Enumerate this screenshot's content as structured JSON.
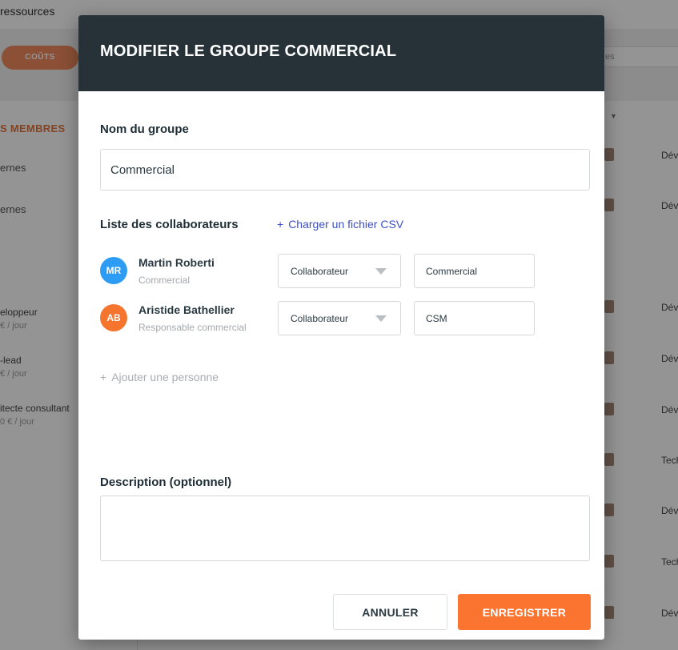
{
  "background": {
    "app_title": "ressources",
    "tab_pill": "COÛTS",
    "search_placeholder": "es",
    "section_title": "S MEMBRES",
    "links": [
      "ernes",
      "ernes"
    ],
    "roles": [
      {
        "title": "eloppeur",
        "rate": "€ / jour"
      },
      {
        "title": "-lead",
        "rate": "€ / jour"
      },
      {
        "title": "itecte consultant",
        "rate": "0 € / jour"
      }
    ],
    "cells": [
      "Dév",
      "Dév",
      "Dév",
      "Dév",
      "Dév",
      "Tech",
      "Dév",
      "Tech",
      "Dév"
    ]
  },
  "modal": {
    "title": "MODIFIER LE GROUPE COMMERCIAL",
    "group_name_label": "Nom du groupe",
    "group_name_value": "Commercial",
    "collaborators_label": "Liste des collaborateurs",
    "csv_link": "Charger un fichier CSV",
    "members": [
      {
        "initials": "MR",
        "name": "Martin Roberti",
        "job": "Commercial",
        "role": "Collaborateur",
        "team": "Commercial",
        "avatar_color": "#2d9cf4"
      },
      {
        "initials": "AB",
        "name": "Aristide Bathellier",
        "job": "Responsable commercial",
        "role": "Collaborateur",
        "team": "CSM",
        "avatar_color": "#f5752f"
      }
    ],
    "add_person": "Ajouter une personne",
    "description_label": "Description (optionnel)",
    "description_value": "",
    "cancel_button": "ANNULER",
    "save_button": "ENREGISTRER"
  },
  "colors": {
    "header": "#263238",
    "primary": "#fb7430",
    "link": "#3c4fc4"
  }
}
